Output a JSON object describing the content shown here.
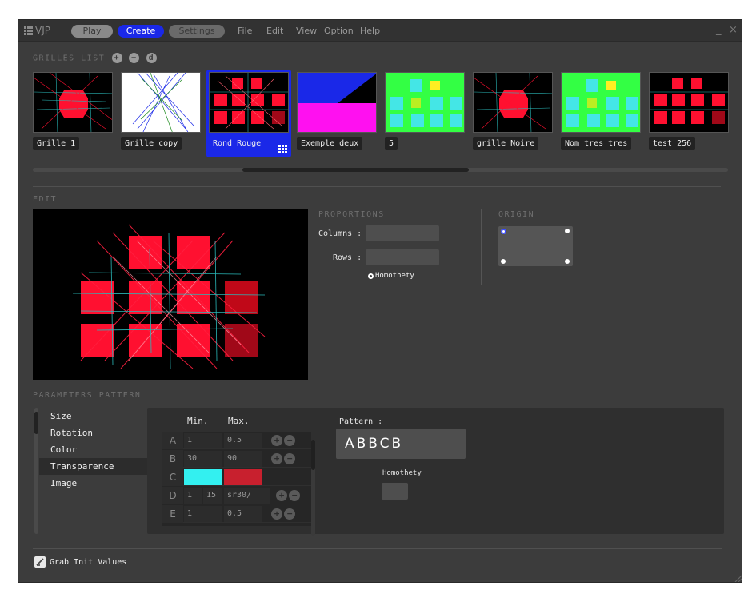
{
  "app": {
    "title": "VJP"
  },
  "modes": [
    {
      "label": "Play",
      "active": false
    },
    {
      "label": "Create",
      "active": true
    },
    {
      "label": "Settings",
      "active": false
    }
  ],
  "menu": [
    "File",
    "Edit",
    "View",
    "Option",
    "Help"
  ],
  "window_controls": {
    "minimize": "_",
    "close": "×"
  },
  "grid_list": {
    "title": "GRILLES LIST",
    "add_icon": "+",
    "remove_icon": "−",
    "duplicate_icon": "d",
    "items": [
      {
        "label": "Grille 1",
        "selected": false
      },
      {
        "label": "Grille copy",
        "selected": false
      },
      {
        "label": "Rond Rouge",
        "selected": true
      },
      {
        "label": "Exemple deux",
        "selected": false
      },
      {
        "label": "5",
        "selected": false
      },
      {
        "label": "grille Noire",
        "selected": false
      },
      {
        "label": "Nom tres tres",
        "selected": false
      },
      {
        "label": "test 256",
        "selected": false
      }
    ]
  },
  "edit": {
    "title": "EDIT",
    "proportions": {
      "title": "PROPORTIONS",
      "columns_label": "Columns :",
      "rows_label": "Rows :",
      "columns_value": "",
      "rows_value": "",
      "homothety_label": "Homothety"
    },
    "origin": {
      "title": "ORIGIN",
      "selected": "top-left"
    }
  },
  "parameters": {
    "title": "PARAMETERS PATTERN",
    "tabs": [
      "Size",
      "Rotation",
      "Color",
      "Transparence",
      "Image"
    ],
    "selected_tab": "Transparence",
    "table": {
      "min_header": "Min.",
      "max_header": "Max.",
      "rows": [
        {
          "key": "A",
          "min": "1",
          "max": "0.5"
        },
        {
          "key": "B",
          "min": "30",
          "max": "90"
        },
        {
          "key": "C",
          "min": "",
          "max": "",
          "min_color": "#33f0f0",
          "max_color": "#c8202e"
        },
        {
          "key": "D",
          "min": "1",
          "min2": "15",
          "max": "sr30/"
        },
        {
          "key": "E",
          "min": "1",
          "max": "0.5"
        }
      ]
    },
    "pattern": {
      "label": "Pattern :",
      "value": "ABBCB",
      "homothety_label": "Homothety"
    }
  },
  "footer": {
    "grab_label": "Grab Init Values"
  },
  "colors": {
    "accent": "#1a28e8",
    "red": "#ff1030",
    "cyan": "#33e0e0",
    "green": "#33ff44"
  }
}
